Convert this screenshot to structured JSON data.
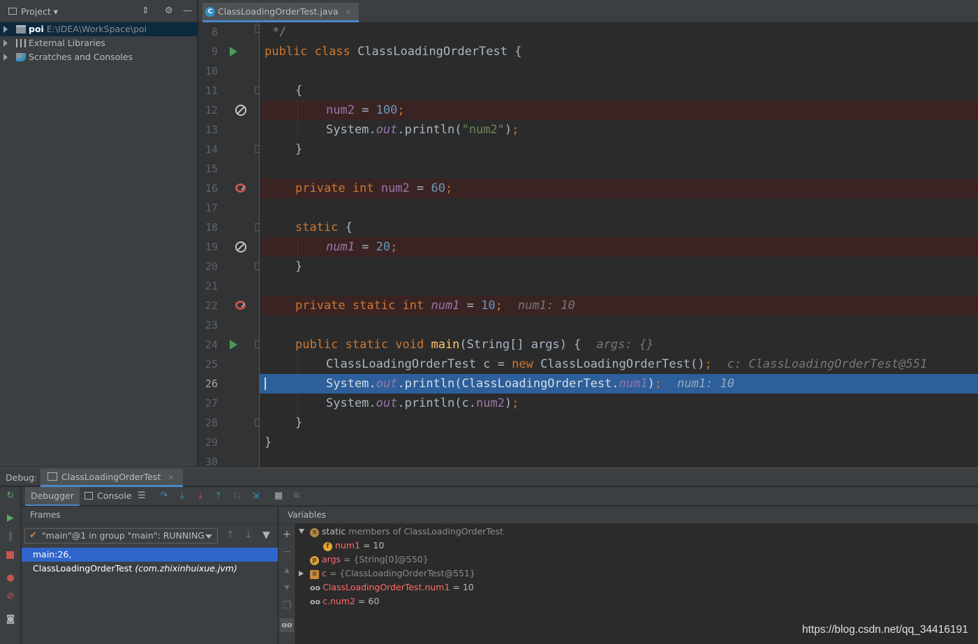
{
  "project": {
    "title": "Project",
    "tree": [
      {
        "name": "poi",
        "path": "E:\\IDEA\\WorkSpace\\poi"
      },
      {
        "name": "External Libraries"
      },
      {
        "name": "Scratches and Consoles"
      }
    ]
  },
  "editor": {
    "tab_label": "ClassLoadingOrderTest.java",
    "tab_icon": "C",
    "line_numbers": [
      "8",
      "9",
      "10",
      "11",
      "12",
      "13",
      "14",
      "15",
      "16",
      "17",
      "18",
      "19",
      "20",
      "21",
      "22",
      "23",
      "24",
      "25",
      "26",
      "27",
      "28",
      "29",
      "30"
    ],
    "code": {
      "l8": "*/",
      "l9_kw": "public class ",
      "l9_name": "ClassLoadingOrderTest {",
      "l11": "{",
      "l12_field": "num2",
      "l12_eq": " = ",
      "l12_val": "100",
      "l12_semi": ";",
      "l13_a": "System.",
      "l13_out": "out",
      "l13_b": ".println(",
      "l13_str": "\"num2\"",
      "l13_c": ")",
      "l13_semi": ";",
      "l14": "}",
      "l16_kw": "private int ",
      "l16_field": "num2",
      "l16_eq": " = ",
      "l16_val": "60",
      "l16_semi": ";",
      "l18_kw": "static ",
      "l18_brace": "{",
      "l19_field": "num1",
      "l19_eq": " = ",
      "l19_val": "20",
      "l19_semi": ";",
      "l20": "}",
      "l22_kw": "private static int ",
      "l22_field": "num1",
      "l22_eq": " = ",
      "l22_val": "10",
      "l22_semi": ";",
      "l22_inline": "num1: 10",
      "l24_kw": "public static void ",
      "l24_method": "main",
      "l24_args": "(String[] args) {",
      "l24_inline": "args: {}",
      "l25_a": "ClassLoadingOrderTest c = ",
      "l25_kw": "new ",
      "l25_b": "ClassLoadingOrderTest()",
      "l25_semi": ";",
      "l25_inline": "c: ClassLoadingOrderTest@551",
      "l26_a": "System.",
      "l26_out": "out",
      "l26_b": ".println(ClassLoadingOrderTest.",
      "l26_field": "num1",
      "l26_c": ")",
      "l26_semi": ";",
      "l26_inline": "num1: 10",
      "l27_a": "System.",
      "l27_out": "out",
      "l27_b": ".println(c.",
      "l27_field": "num2",
      "l27_c": ")",
      "l27_semi": ";",
      "l28": "}",
      "l29": "}"
    }
  },
  "debug": {
    "label": "Debug:",
    "tab_label": "ClassLoadingOrderTest",
    "tabs": {
      "debugger": "Debugger",
      "console": "Console"
    },
    "frames": {
      "header": "Frames",
      "thread": "\"main\"@1 in group \"main\": RUNNING",
      "frame_method": "main:26, ClassLoadingOrderTest",
      "frame_package": "(com.zhixinhuixue.jvm)"
    },
    "variables": {
      "header": "Variables",
      "rows": [
        {
          "prefix": "static",
          "text": " members of ClassLoadingOrderTest"
        },
        {
          "name": "num1",
          "value": " = 10"
        },
        {
          "name": "args",
          "value": " = {String[0]@550}"
        },
        {
          "name": "c",
          "value": " = {ClassLoadingOrderTest@551}"
        },
        {
          "name": "ClassLoadingOrderTest.num1",
          "value": " = 10"
        },
        {
          "name": "c.num2",
          "value": " = 60"
        }
      ]
    }
  },
  "watermark": "https://blog.csdn.net/qq_34416191",
  "colors": {
    "keyword": "#cc7832",
    "number": "#6897bb",
    "string": "#6a8759",
    "field": "#9876aa",
    "method": "#ffc66d",
    "execution_line": "#2d5f9b",
    "breakpoint_line": "#3a2323",
    "selection": "#2f65ca"
  },
  "icons": [
    "project-icon",
    "folder-icon",
    "library-icon",
    "scratches-icon",
    "java-class-icon",
    "run-gutter-icon",
    "breakpoint-disabled-icon",
    "field-breakpoint-icon",
    "rerun-icon",
    "resume-icon",
    "pause-icon",
    "stop-icon",
    "view-breakpoints-icon",
    "mute-breakpoints-icon",
    "camera-icon",
    "step-over-icon",
    "step-into-icon",
    "force-step-into-icon",
    "step-out-icon",
    "drop-frame-icon",
    "run-to-cursor-icon",
    "evaluate-icon",
    "trace-icon",
    "add-watch-icon",
    "remove-watch-icon",
    "up-icon",
    "down-icon",
    "filter-icon",
    "copy-icon",
    "glasses-icon"
  ]
}
